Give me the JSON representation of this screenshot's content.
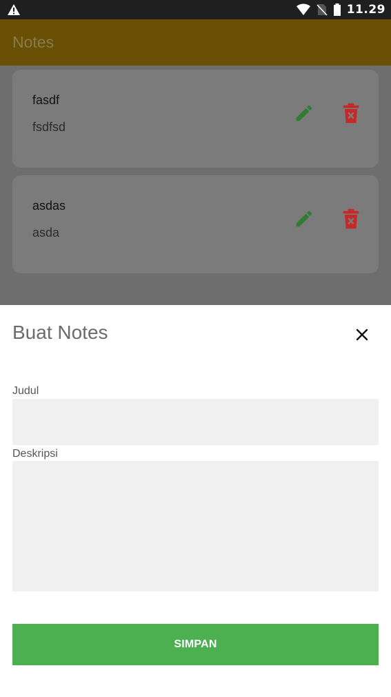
{
  "status_bar": {
    "time": "11.29"
  },
  "app_bar": {
    "title": "Notes"
  },
  "notes": [
    {
      "title": "fasdf",
      "description": "fsdfsd"
    },
    {
      "title": "asdas",
      "description": "asda"
    }
  ],
  "sheet": {
    "title": "Buat Notes",
    "fields": {
      "judul": {
        "label": "Judul",
        "value": "",
        "placeholder": ""
      },
      "deskripsi": {
        "label": "Deskripsi",
        "value": "",
        "placeholder": ""
      }
    },
    "save_label": "SIMPAN"
  },
  "colors": {
    "app_bar": "#694f03",
    "edit_icon": "#2e7d32",
    "delete_icon": "#c62828",
    "save_button": "#4caf50"
  },
  "icons": {
    "alert": "warning-icon",
    "wifi": "wifi-icon",
    "no_sim": "no-sim-icon",
    "battery": "battery-icon",
    "edit": "pencil-icon",
    "delete": "trash-icon",
    "close": "close-icon"
  }
}
